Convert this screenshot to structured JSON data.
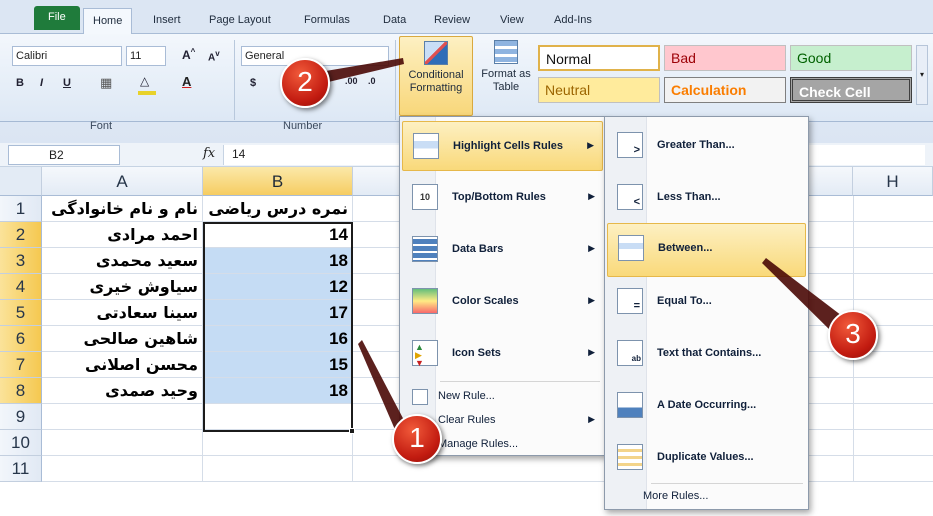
{
  "ribbon": {
    "tabs": [
      "File",
      "Home",
      "Insert",
      "Page Layout",
      "Formulas",
      "Data",
      "Review",
      "View",
      "Add-Ins"
    ],
    "font_name": "Calibri",
    "font_size": "11",
    "number_format": "General",
    "group_font": "Font",
    "group_number": "Number",
    "conditional_formatting": [
      "Conditional",
      "Formatting"
    ],
    "format_as_table": [
      "Format as",
      "Table"
    ],
    "styles": {
      "normal": "Normal",
      "bad": "Bad",
      "good": "Good",
      "neutral": "Neutral",
      "calculation": "Calculation",
      "check_cell": "Check Cell"
    }
  },
  "formula_bar": {
    "name_box": "B2",
    "fx": "fx",
    "value": "14"
  },
  "grid": {
    "columns": [
      "A",
      "B",
      "H"
    ],
    "rows": [
      "1",
      "2",
      "3",
      "4",
      "5",
      "6",
      "7",
      "8",
      "9",
      "10",
      "11"
    ],
    "header_a": "نام و نام خانوادگی",
    "header_b": "نمره درس ریاضی",
    "names": [
      "احمد مرادی",
      "سعید محمدی",
      "سیاوش خیری",
      "سینا سعادتی",
      "شاهین صالحی",
      "محسن اصلانی",
      "وحید صمدی"
    ],
    "scores": [
      "14",
      "18",
      "12",
      "17",
      "16",
      "15",
      "18"
    ]
  },
  "menu_cf": {
    "items": [
      "Highlight Cells Rules",
      "Top/Bottom Rules",
      "Data Bars",
      "Color Scales",
      "Icon Sets"
    ],
    "new_rule": "New Rule...",
    "clear_rules": "Clear Rules",
    "manage_rules": "Manage Rules..."
  },
  "menu_highlight": {
    "items": [
      "Greater Than...",
      "Less Than...",
      "Between...",
      "Equal To...",
      "Text that Contains...",
      "A Date Occurring...",
      "Duplicate Values..."
    ],
    "more_rules": "More Rules..."
  },
  "callouts": [
    "1",
    "2",
    "3"
  ],
  "colors": {
    "file_tab": "#1f7b3b",
    "highlight": "#f9d97a",
    "selection_fill": "#c5dcf4",
    "callout": "#c21b10"
  }
}
